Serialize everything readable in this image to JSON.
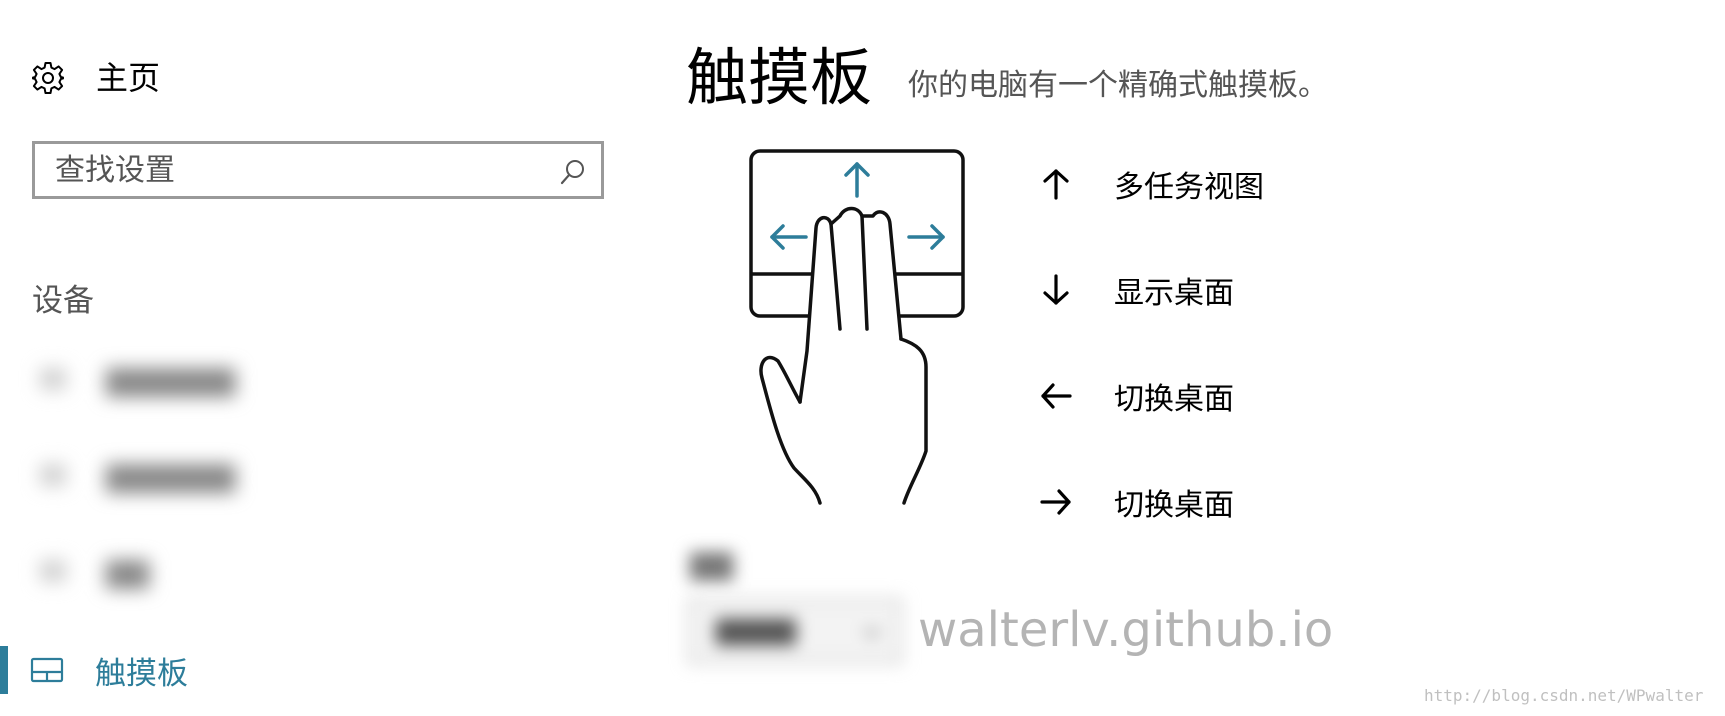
{
  "sidebar": {
    "home": {
      "icon": "gear-icon",
      "label": "主页"
    },
    "search": {
      "placeholder": "查找设置",
      "value": "",
      "icon": "search-icon"
    },
    "section_title": "设备",
    "selected_item": {
      "icon": "touchpad-icon",
      "label": "触摸板"
    }
  },
  "main": {
    "title": "触摸板",
    "subtitle": "你的电脑有一个精确式触摸板。",
    "illustration": "three-finger-touchpad-gesture",
    "gestures": [
      {
        "icon": "arrow-up-icon",
        "label": "多任务视图"
      },
      {
        "icon": "arrow-down-icon",
        "label": "显示桌面"
      },
      {
        "icon": "arrow-left-icon",
        "label": "切换桌面"
      },
      {
        "icon": "arrow-right-icon",
        "label": "切换桌面"
      }
    ]
  },
  "overlay": {
    "watermark": "walterlv.github.io",
    "source_credit": "http://blog.csdn.net/WPwalter"
  },
  "colors": {
    "accent": "#2d7d9a",
    "search_border": "#9a9a9a",
    "watermark": "#b4b4b4"
  }
}
